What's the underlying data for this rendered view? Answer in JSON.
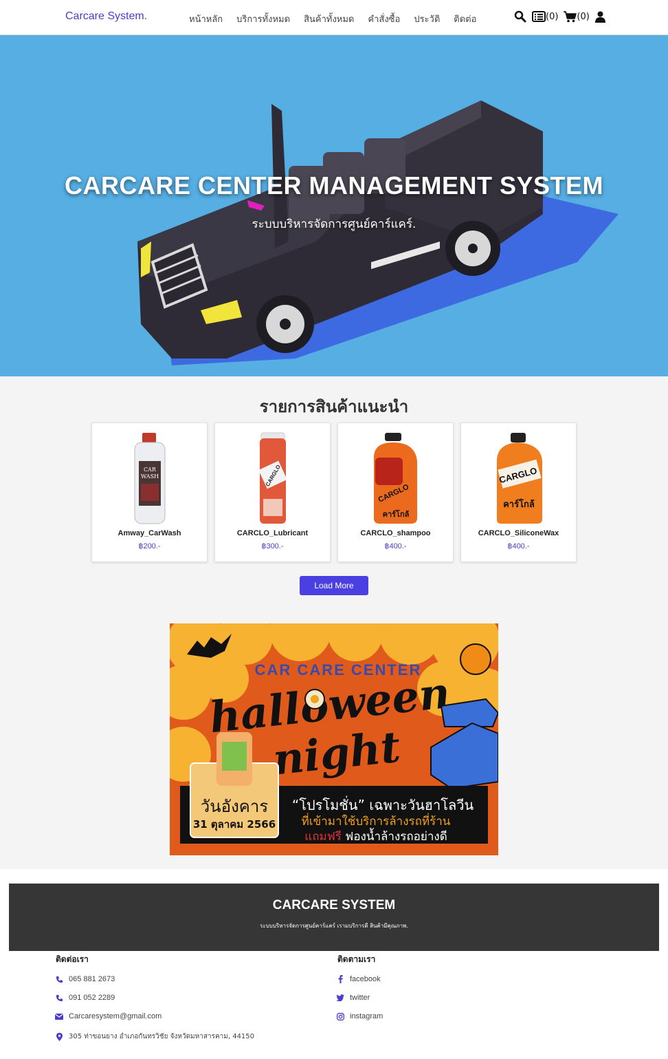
{
  "nav": {
    "brand": "Carcare System.",
    "links": [
      "หน้าหลัก",
      "บริการทั้งหมด",
      "สินค้าทั้งหมด",
      "คำสั่งซื้อ",
      "ประวัติ",
      "ติดต่อ"
    ],
    "orders_count": "(0)",
    "cart_count": "(0)"
  },
  "hero": {
    "title": "CARCARE CENTER MANAGEMENT SYSTEM",
    "subtitle": "ระบบบริหารจัดการศูนย์คาร์แคร์."
  },
  "products": {
    "title": "รายการสินค้าแนะนำ",
    "items": [
      {
        "name": "Amway_CarWash",
        "price": "฿200.-"
      },
      {
        "name": "CARCLO_Lubricant",
        "price": "฿300.-"
      },
      {
        "name": "CARCLO_shampoo",
        "price": "฿400.-"
      },
      {
        "name": "CARCLO_SiliconeWax",
        "price": "฿400.-"
      }
    ],
    "load_more": "Load More"
  },
  "promo": {
    "header": "CAR CARE CENTER",
    "word1": "halloween",
    "word2": "night",
    "day": "วันอังคาร",
    "date": "31 ตุลาคม 2566",
    "line1": "“โปรโมชั่น” เฉพาะวันฮาโลวีน",
    "line2": "ที่เข้ามาใช้บริการล้างรถที่ร้าน",
    "line3a": "แถมฟรี",
    "line3b": " ฟองน้ำล้างรถอย่างดี"
  },
  "footer": {
    "title": "CARCARE SYSTEM",
    "description": "ระบบบริหารจัดการศูนย์คาร์แคร์ เรามบริการดี สินค้ามีคุณภาพ.",
    "contact_title": "ติดต่อเรา",
    "phone1": "065 881 2673",
    "phone2": "091 052 2289",
    "email": "Carcaresystem@gmail.com",
    "address": "305 ท่าขอนยาง อำเภอกันทรวิชัย จังหวัดมหาสารคาม, 44150",
    "follow_title": "ติดตามเรา",
    "facebook": "facebook",
    "twitter": "twitter",
    "instagram": "instagram"
  }
}
